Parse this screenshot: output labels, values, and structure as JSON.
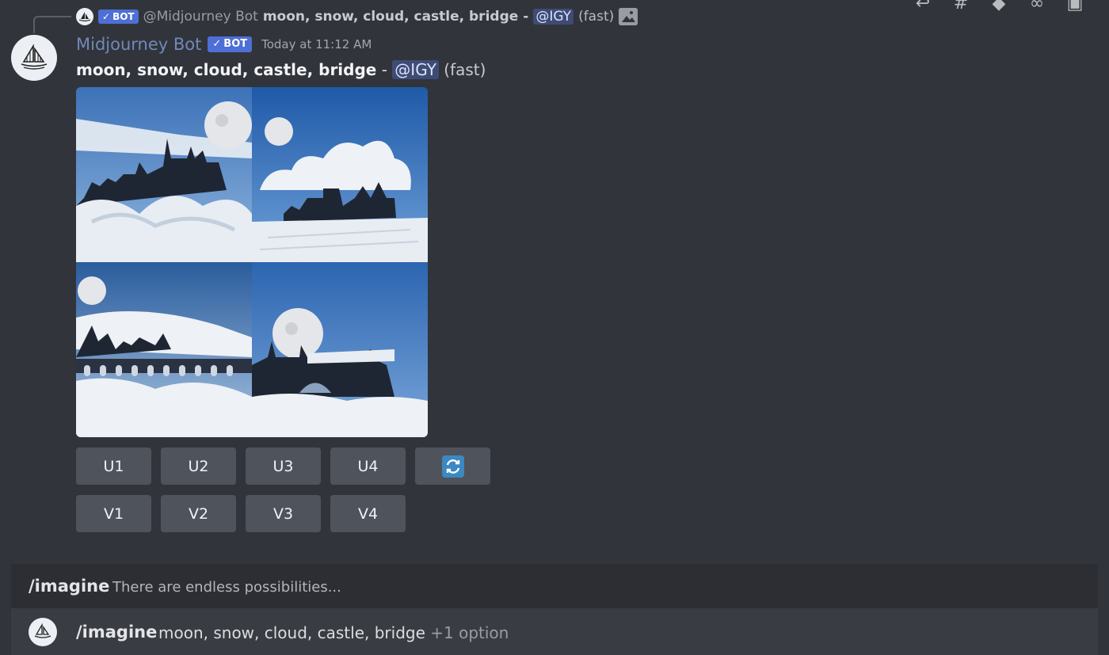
{
  "reply": {
    "badge": "BOT",
    "author": "@Midjourney Bot",
    "prompt": "moon, snow, cloud, castle, bridge",
    "separator": "-",
    "mention": "@IGY",
    "mode": "(fast)"
  },
  "toolbar": {
    "icons": [
      "reply-icon",
      "create-thread-icon",
      "apps-icon",
      "copy-link-icon",
      "copy-id-icon"
    ]
  },
  "message": {
    "author": "Midjourney Bot",
    "badge": "BOT",
    "timestamp": "Today at 11:12 AM",
    "prompt": "moon, snow, cloud, castle, bridge",
    "separator": "-",
    "mention": "@IGY",
    "mode": "(fast)"
  },
  "buttons": {
    "upscale": [
      "U1",
      "U2",
      "U3",
      "U4"
    ],
    "variation": [
      "V1",
      "V2",
      "V3",
      "V4"
    ],
    "reroll_icon": "refresh-icon"
  },
  "composer": {
    "command": "/imagine",
    "placeholder": "There are endless possibilities..."
  },
  "suggestion": {
    "command": "/imagine",
    "args": "moon, snow, cloud, castle, bridge",
    "extra": "+1 option"
  },
  "colors": {
    "background": "#32343b",
    "bot_badge": "#4e6fd6",
    "author_name": "#7089b6",
    "mention_bg": "#3e4c75",
    "button_bg": "#4f535c",
    "reroll_blue": "#3b88c3"
  }
}
